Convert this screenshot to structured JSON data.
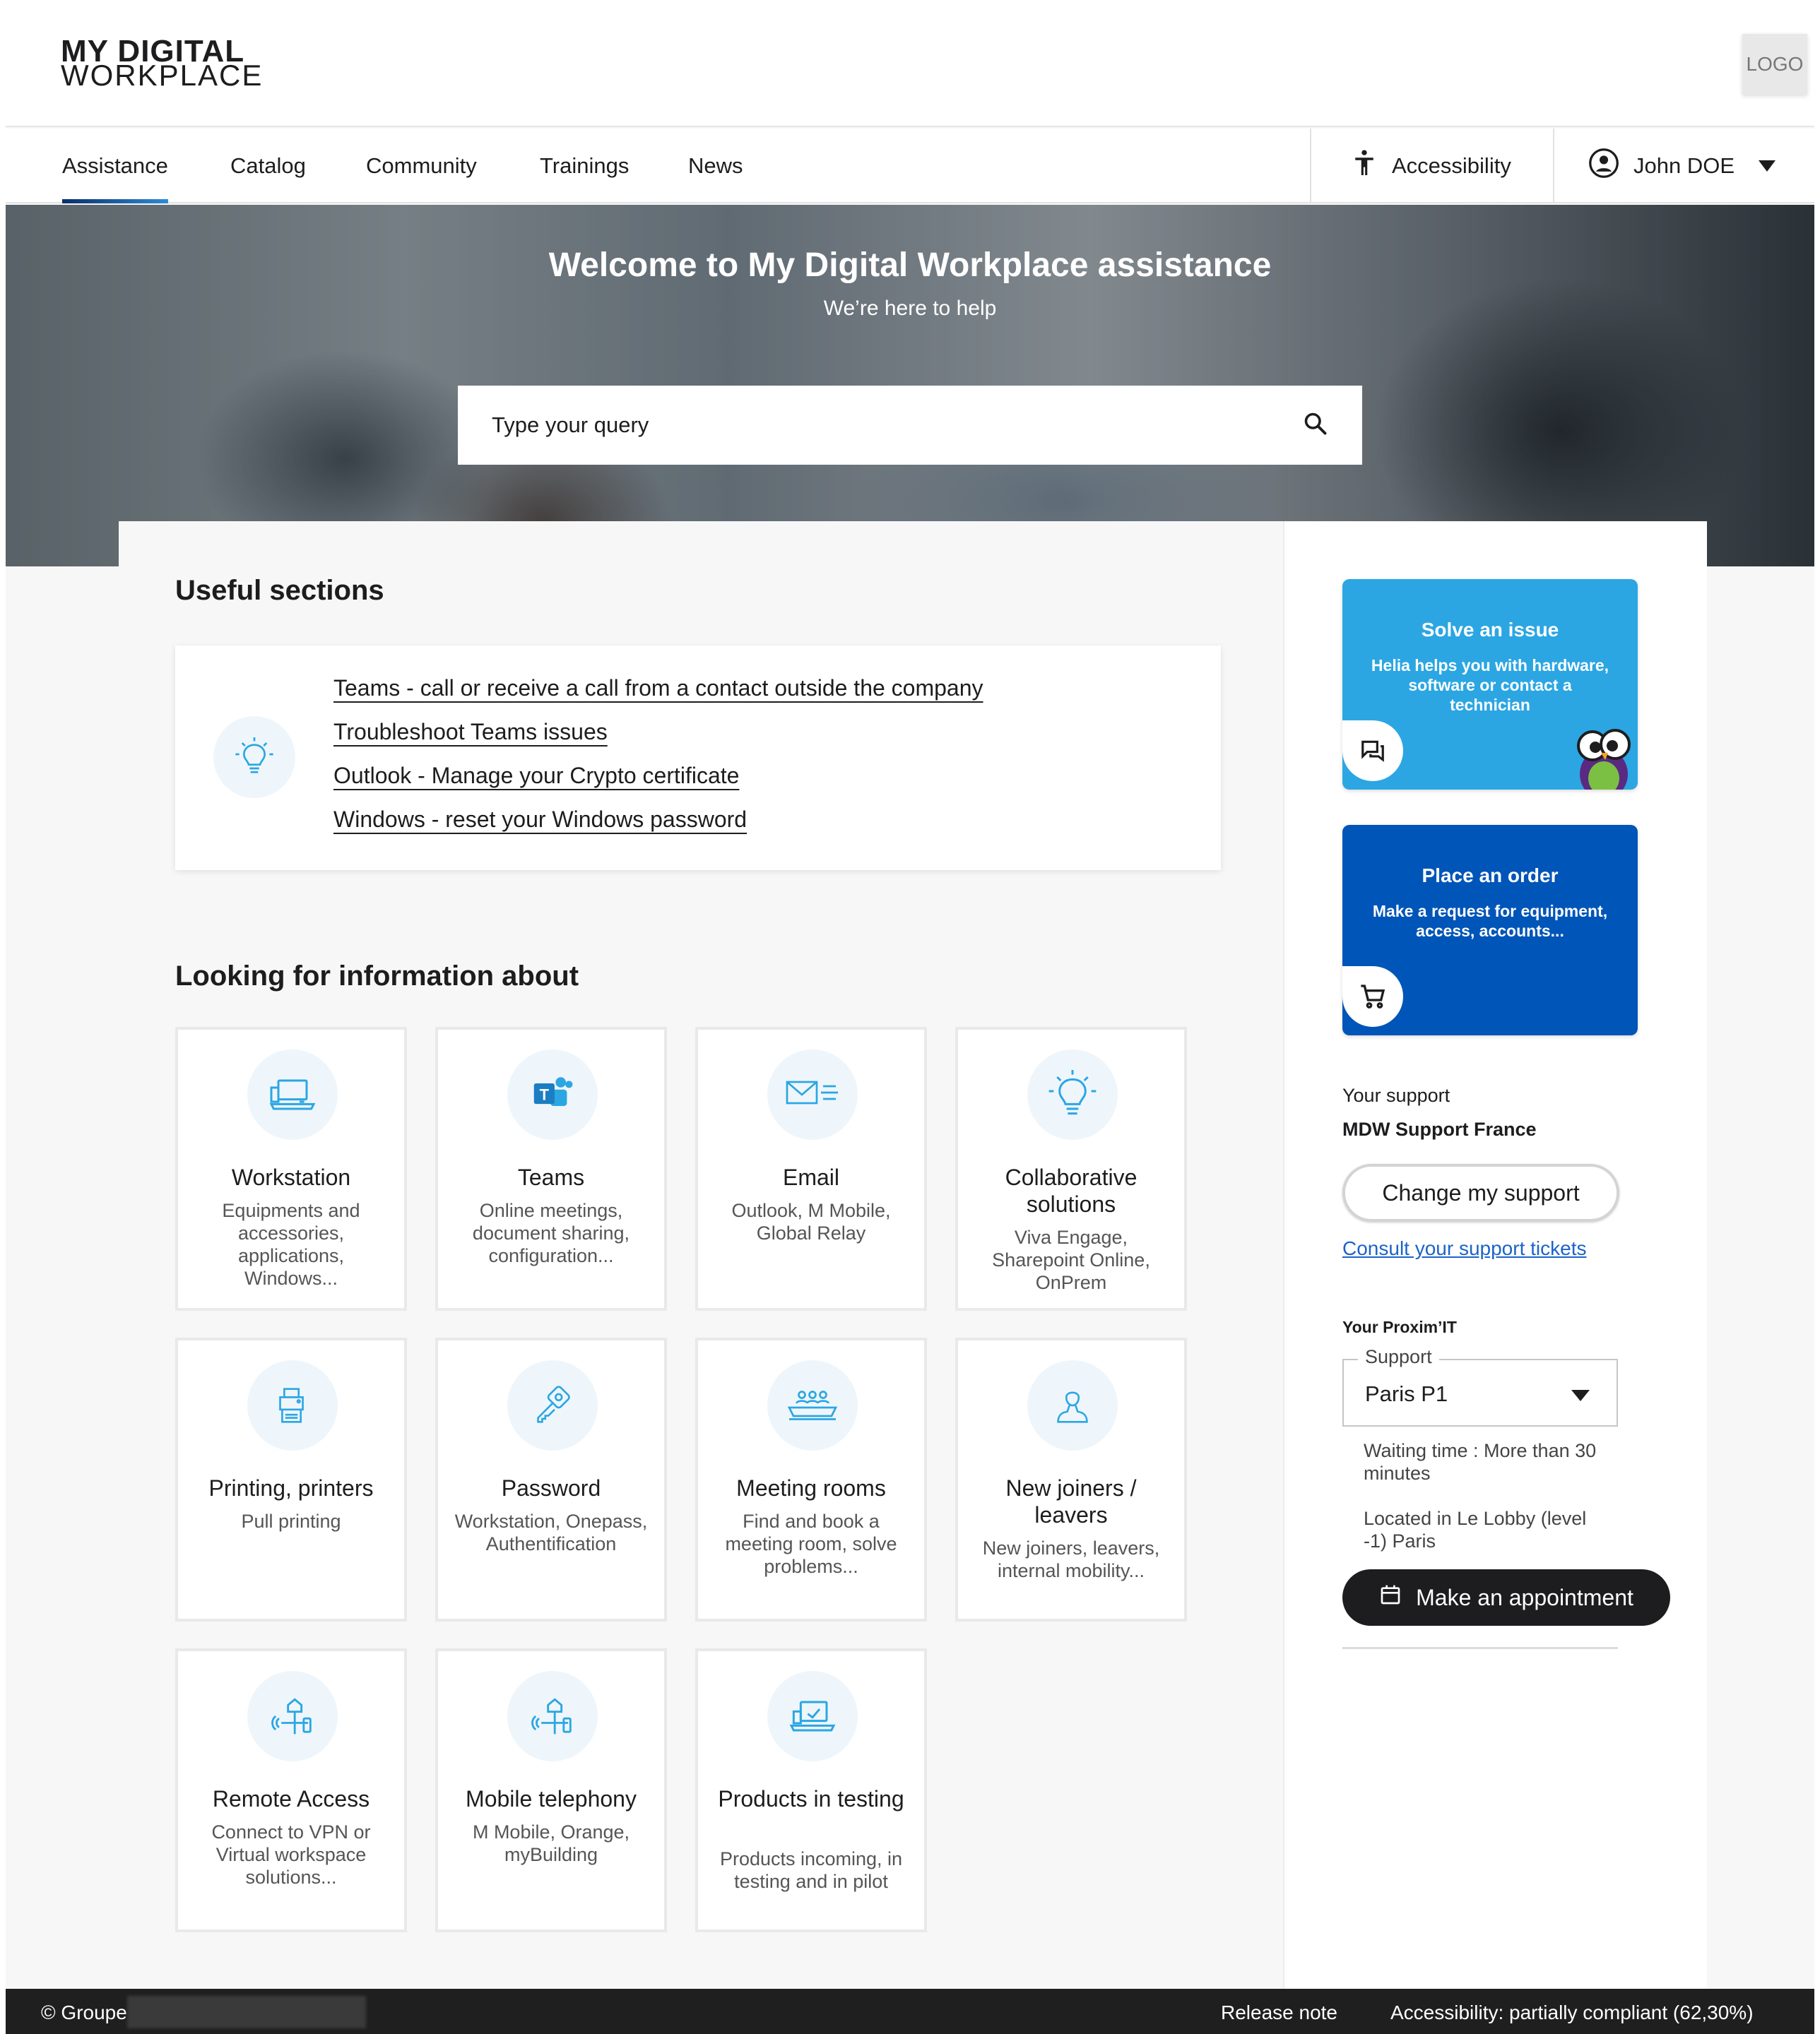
{
  "brand": {
    "line1": "MY DIGITAL",
    "line2": "WORKPLACE",
    "logo_placeholder": "LOGO"
  },
  "nav": {
    "items": [
      {
        "label": "Assistance",
        "active": true
      },
      {
        "label": "Catalog"
      },
      {
        "label": "Community"
      },
      {
        "label": "Trainings"
      },
      {
        "label": "News"
      }
    ],
    "accessibility": "Accessibility",
    "user": "John DOE"
  },
  "hero": {
    "title": "Welcome to My Digital Workplace assistance",
    "subtitle": "We’re here to help",
    "search_placeholder": "Type your query"
  },
  "useful": {
    "heading": "Useful sections",
    "links": [
      "Teams - call or receive a call from a contact outside the company",
      "Troubleshoot Teams issues",
      "Outlook - Manage your Crypto certificate",
      "Windows - reset your Windows password"
    ]
  },
  "info": {
    "heading": "Looking for information about",
    "tiles": [
      {
        "title": "Workstation",
        "desc": "Equipments and accessories, applications, Windows...",
        "icon": "laptop-icon"
      },
      {
        "title": "Teams",
        "desc": "Online meetings, document sharing, configuration...",
        "icon": "teams-icon"
      },
      {
        "title": "Email",
        "desc": "Outlook, M Mobile, Global Relay",
        "icon": "email-icon"
      },
      {
        "title": "Collaborative solutions",
        "desc": "Viva Engage, Sharepoint Online, OnPrem",
        "icon": "lightbulb-icon"
      },
      {
        "title": "Printing, printers",
        "desc": "Pull printing",
        "icon": "printer-icon"
      },
      {
        "title": "Password",
        "desc": "Workstation, Onepass, Authentification",
        "icon": "key-icon"
      },
      {
        "title": "Meeting rooms",
        "desc": "Find and book a meeting room, solve problems...",
        "icon": "meeting-room-icon"
      },
      {
        "title": "New joiners / leavers",
        "desc": "New joiners, leavers, internal mobility...",
        "icon": "person-icon"
      },
      {
        "title": "Remote Access",
        "desc": "Connect to VPN or Virtual workspace solutions...",
        "icon": "remote-access-icon"
      },
      {
        "title": "Mobile telephony",
        "desc": "M Mobile, Orange, myBuilding",
        "icon": "mobile-icon"
      },
      {
        "title": "Products in testing",
        "desc": "Products incoming, in testing and in pilot",
        "icon": "laptop-test-icon"
      }
    ]
  },
  "sidebar": {
    "solve": {
      "title": "Solve an issue",
      "desc": "Helia helps you with hardware, software or contact a technician",
      "color": "#2ba6e3"
    },
    "order": {
      "title": "Place an order",
      "desc": "Make a request for equipment, access, accounts...",
      "color": "#0055b8"
    },
    "support_label": "Your support",
    "support_name": "MDW Support France",
    "change_support": "Change my support",
    "consult_tickets": "Consult your support tickets",
    "proximit_label": "Your Proxim’IT",
    "select_legend": "Support",
    "select_value": "Paris P1",
    "waiting": "Waiting time : More than 30 minutes",
    "location": "Located in Le Lobby (level -1)  Paris",
    "appointment": "Make an appointment"
  },
  "footer": {
    "copyright": "© Groupe",
    "release_note": "Release note",
    "accessibility": "Accessibility: partially compliant (62,30%)"
  }
}
